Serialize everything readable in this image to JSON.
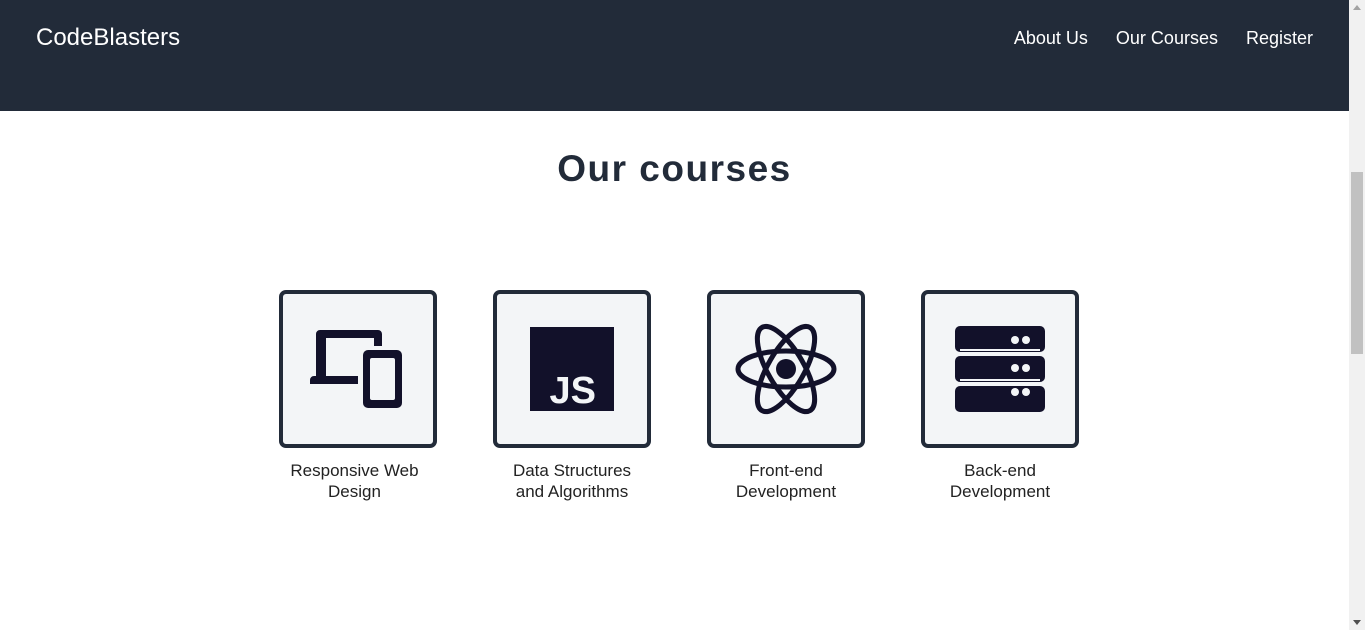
{
  "nav": {
    "brand": "CodeBlasters",
    "links": [
      "About Us",
      "Our Courses",
      "Register"
    ]
  },
  "main": {
    "title": "Our courses",
    "courses": [
      {
        "label": "Responsive Web Design",
        "icon": "responsive-devices-icon"
      },
      {
        "label": "Data Structures and Algorithms",
        "icon": "javascript-icon"
      },
      {
        "label": "Front-end Development",
        "icon": "react-atom-icon"
      },
      {
        "label": "Back-end Development",
        "icon": "server-icon"
      }
    ]
  },
  "colors": {
    "navbar": "#222b39",
    "card_border": "#222b39",
    "card_background": "#f3f5f7",
    "icon": "#12112a"
  }
}
